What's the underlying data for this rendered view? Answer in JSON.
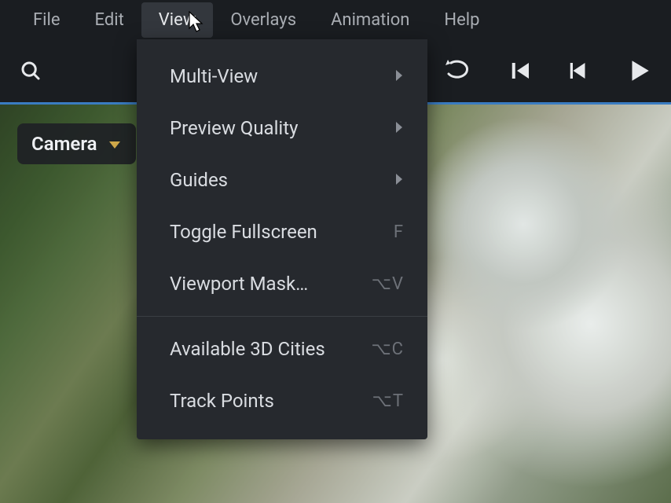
{
  "menubar": {
    "items": [
      "File",
      "Edit",
      "View",
      "Overlays",
      "Animation",
      "Help"
    ],
    "active_index": 2
  },
  "toolbar": {
    "search_icon": "search-icon",
    "loop_icon": "loop-icon",
    "prev_icon": "skip-start-icon",
    "step_back_icon": "step-back-icon",
    "play_icon": "play-icon"
  },
  "viewport": {
    "camera_chip_label": "Camera"
  },
  "view_menu": {
    "items": [
      {
        "label": "Multi-View",
        "submenu": true
      },
      {
        "label": "Preview Quality",
        "submenu": true
      },
      {
        "label": "Guides",
        "submenu": true
      },
      {
        "label": "Toggle Fullscreen",
        "shortcut": "F"
      },
      {
        "label": "Viewport Mask…",
        "shortcut": "⌥V"
      }
    ],
    "items2": [
      {
        "label": "Available 3D Cities",
        "shortcut": "⌥C"
      },
      {
        "label": "Track Points",
        "shortcut": "⌥T"
      }
    ]
  }
}
